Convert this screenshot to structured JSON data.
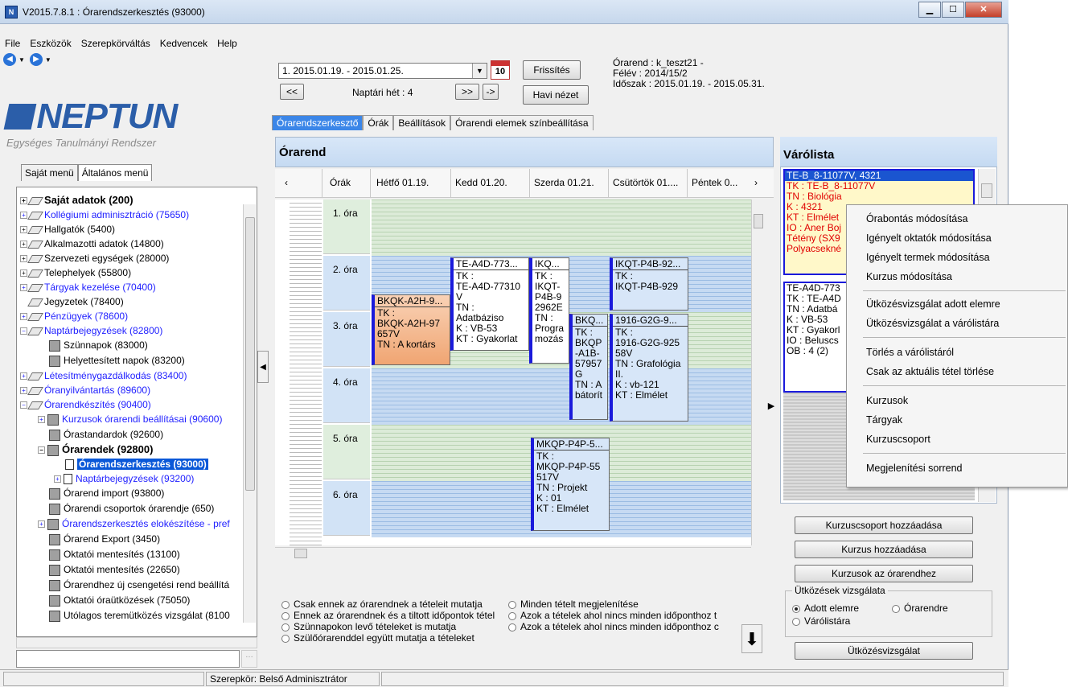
{
  "window": {
    "title": "V2015.7.8.1 : Órarendszerkesztés (93000)",
    "app_icon": "N"
  },
  "menu": [
    "File",
    "Eszközök",
    "Szerepkörváltás",
    "Kedvencek",
    "Help"
  ],
  "logo": {
    "word": "NEPTUN",
    "subtitle": "Egységes Tanulmányi Rendszer"
  },
  "left_tabs": [
    "Saját menü",
    "Általános menü"
  ],
  "tree": [
    {
      "label": "Saját adatok (200)",
      "bold": true,
      "color": "black"
    },
    {
      "label": "Kollégiumi adminisztráció (75650)",
      "color": "blue"
    },
    {
      "label": "Hallgatók (5400)"
    },
    {
      "label": "Alkalmazotti adatok (14800)"
    },
    {
      "label": "Szervezeti egységek (28000)"
    },
    {
      "label": "Telephelyek (55800)"
    },
    {
      "label": "Tárgyak kezelése (70400)",
      "color": "blue"
    },
    {
      "label": "Jegyzetek (78400)"
    },
    {
      "label": "Pénzügyek (78600)",
      "color": "blue"
    },
    {
      "label": "Naptárbejegyzések (82800)",
      "color": "blue"
    },
    {
      "label": "Szünnapok (83000)"
    },
    {
      "label": "Helyettesített napok (83200)"
    },
    {
      "label": "Létesítménygazdálkodás (83400)",
      "color": "blue"
    },
    {
      "label": "Óranyilvántartás (89600)",
      "color": "blue"
    },
    {
      "label": "Órarendkészítés (90400)",
      "color": "blue"
    },
    {
      "label": "Kurzusok órarendi beállításai (90600)",
      "color": "blue"
    },
    {
      "label": "Órastandardok (92600)"
    },
    {
      "label": "Órarendek (92800)",
      "bold": true
    },
    {
      "label": "Órarendszerkesztés (93000)",
      "selected": true
    },
    {
      "label": "Naptárbejegyzések (93200)",
      "color": "blue"
    },
    {
      "label": "Órarend import (93800)"
    },
    {
      "label": "Órarendi csoportok órarendje (650)"
    },
    {
      "label": "Órarendszerkesztés elokészítése - pref",
      "color": "blue"
    },
    {
      "label": "Órarend Export (3450)"
    },
    {
      "label": "Oktatói mentesítés (13100)"
    },
    {
      "label": "Oktatói mentesítés (22650)"
    },
    {
      "label": "Órarendhez új csengetési rend beállítá"
    },
    {
      "label": "Oktatói óraütközések (75050)"
    },
    {
      "label": "Utólagos teremütközés vizsgálat (8100"
    }
  ],
  "status": {
    "role": "Szerepkör: Belső Adminisztrátor"
  },
  "controls": {
    "week_select": "1. 2015.01.19. - 2015.01.25.",
    "cal_day": "10",
    "refresh": "Frissítés",
    "prev": "<<",
    "week_label": "Naptári hét : 4",
    "next": ">>",
    "goto": "->",
    "month_view": "Havi nézet"
  },
  "info": {
    "orarend": "Órarend : k_teszt21 -",
    "felev": "Félév : 2014/15/2",
    "idoszak": "Időszak : 2015.01.19. - 2015.05.31."
  },
  "main_tabs": [
    "Órarendszerkesztő",
    "Órák",
    "Beállítások",
    "Órarendi elemek színbeállítása"
  ],
  "grid": {
    "title": "Órarend",
    "columns": [
      "Órák",
      "Hétfő 01.19.",
      "Kedd 01.20.",
      "Szerda 01.21.",
      "Csütörtök 01....",
      "Péntek 0..."
    ],
    "periods": [
      "1. óra",
      "2. óra",
      "3. óra",
      "4. óra",
      "5. óra",
      "6. óra"
    ],
    "cards": [
      {
        "head": "BKQK-A2H-9...",
        "body": [
          "TK :",
          "BKQK-A2H-97",
          "657V",
          "TN : A kortárs"
        ]
      },
      {
        "head": "TE-A4D-773...",
        "body": [
          "TK :",
          "TE-A4D-77310",
          "V",
          "TN :",
          "Adatbáziso",
          "K : VB-53",
          "KT : Gyakorlat"
        ]
      },
      {
        "head": "IKQ...",
        "body": [
          "TK :",
          "IKQT-",
          "P4B-9",
          "2962E",
          "TN :",
          "Progra",
          "mozás"
        ]
      },
      {
        "head": "BKQ...",
        "body": [
          "TK :",
          "BKQP",
          "-A1B-",
          "57957",
          "G",
          "TN : A",
          "bátorít"
        ]
      },
      {
        "head": "IKQT-P4B-92...",
        "body": [
          "TK :",
          "IKQT-P4B-929"
        ]
      },
      {
        "head": "1916-G2G-9...",
        "body": [
          "TK :",
          "1916-G2G-925",
          "58V",
          "TN : Grafológia",
          "II.",
          "K : vb-121",
          "KT : Elmélet"
        ]
      },
      {
        "head": "MKQP-P4P-5...",
        "body": [
          "TK :",
          "MKQP-P4P-55",
          "517V",
          "TN : Projekt",
          "K : 01",
          "KT : Elmélet"
        ]
      }
    ]
  },
  "filters": [
    {
      "label": "Csak ennek az órarendnek a tételeit mutatja"
    },
    {
      "label": "Minden tételt megjelenítése"
    },
    {
      "label": "Ennek az órarendnek és a tiltott időpontok tétel"
    },
    {
      "label": "Azok a tételek ahol nincs minden időponthoz t"
    },
    {
      "label": "Szünnapokon levő tételeket is mutatja"
    },
    {
      "label": "Azok a tételek ahol nincs minden időponthoz c"
    },
    {
      "label": "Szülőórarenddel együtt mutatja a tételeket"
    }
  ],
  "waitlist": {
    "title": "Várólista",
    "card1": [
      "TE-B_8-11077V, 4321",
      "TK : TE-B_8-11077V",
      "TN : Biológia",
      "K : 4321",
      "KT : Elmélet",
      "IO : Aner Boj",
      "Tétény (SX9",
      "Polyacsekné"
    ],
    "card2": [
      "TE-A4D-773",
      "TK : TE-A4D",
      "TN : Adatbá",
      "K : VB-53",
      "KT : Gyakorl",
      "IO : Beluscs",
      "OB : 4 (2)"
    ]
  },
  "right_buttons": [
    "Kurzuscsoport hozzáadása",
    "Kurzus hozzáadása",
    "Kurzusok az órarendhez",
    "Ütközésvizsgálat"
  ],
  "collision_group": {
    "legend": "Ütközések vizsgálata",
    "options": [
      "Adott elemre",
      "Órarendre",
      "Várólistára"
    ]
  },
  "context_menu": [
    "Órabontás módosítása",
    "Igényelt oktatók módosítása",
    "Igényelt termek módosítása",
    "Kurzus módosítása",
    "Ütközésvizsgálat adott elemre",
    "Ütközésvizsgálat a várólistára",
    "Törlés a várólistáról",
    "Csak az aktuális tétel törlése",
    "Kurzusok",
    "Tárgyak",
    "Kurzuscsoport",
    "Megjelenítési sorrend"
  ],
  "colors": {
    "accent": "#0a58d8",
    "link": "#1e1eff",
    "card_border": "#1a1adb",
    "waitlist_red": "#e00000"
  }
}
